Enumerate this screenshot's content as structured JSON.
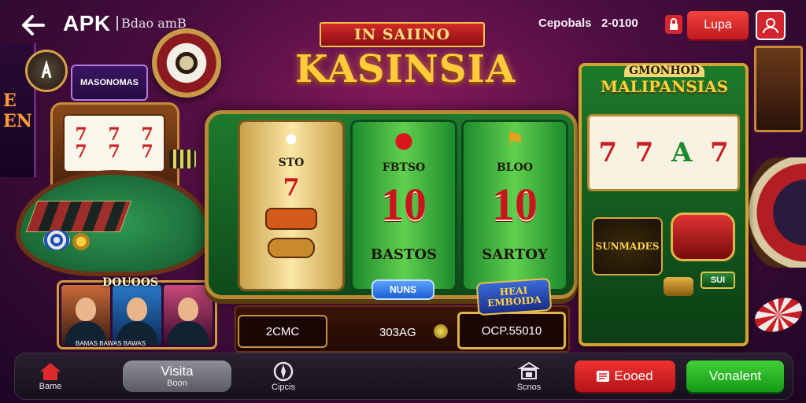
{
  "topbar": {
    "back_icon": "arrow-left-icon",
    "title": "APK",
    "subtitle": "Bdao amB",
    "deposits_label": "Cepobals",
    "balance": "2-0100",
    "login_label": "Lupa",
    "lock_icon": "lock-icon",
    "user_icon": "user-icon"
  },
  "left_panel": {
    "arch_text": "E EN",
    "promo_tag": "MASONOMAS",
    "players_label": "DOUOOS",
    "players_caption": "BAMAS BAWAS BAWAS"
  },
  "logo": {
    "banner": "IN SAIINO",
    "title": "KASINSIA"
  },
  "main_machine": {
    "reels": [
      {
        "top_label": "STO",
        "number": "",
        "bottom_label": ""
      },
      {
        "top_label": "FBTSO",
        "number": "10",
        "bottom_label": "BASTOS"
      },
      {
        "top_label": "BLOO",
        "number": "10",
        "bottom_label": "SARTOY"
      }
    ],
    "nums_button": "NUNS",
    "jackpot_badge": "HEAI EMBOIDA",
    "coins_value": "2CMC",
    "bet_label": "303AG",
    "win_value": "OCP.55010"
  },
  "right_machine": {
    "top_label_1": "GMONHOD",
    "top_label_2": "MALIPANSIAS",
    "reel_symbols": [
      "7",
      "7",
      "A",
      "7"
    ],
    "logo_text": "SUNMADES",
    "small_button": "SUI"
  },
  "bottom_nav": {
    "home_label": "Bame",
    "visit_main": "Visita",
    "visit_sub": "Boon",
    "games_label": "Cipcis",
    "deposits_label": "Scnos",
    "register_label": "Eooed",
    "install_label": "Vonalent"
  },
  "colors": {
    "background": "#4a0d3f",
    "accent_red": "#d3252d",
    "accent_green": "#2fb52a",
    "gold": "#d4a232"
  }
}
